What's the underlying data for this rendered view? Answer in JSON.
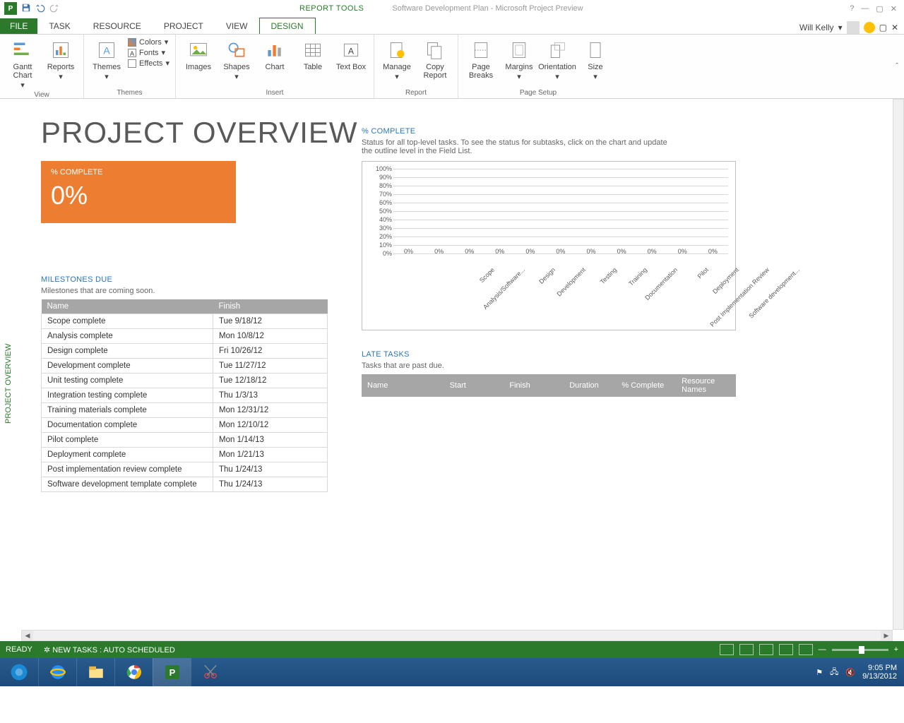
{
  "window": {
    "app_context": "REPORT TOOLS",
    "doc_title": "Software Development Plan - Microsoft Project Preview",
    "user_name": "Will Kelly"
  },
  "tabs": {
    "file": "FILE",
    "task": "TASK",
    "resource": "RESOURCE",
    "project": "PROJECT",
    "view": "VIEW",
    "design": "DESIGN"
  },
  "ribbon": {
    "view": {
      "gantt": "Gantt Chart",
      "reports": "Reports",
      "label": "View"
    },
    "themes": {
      "themes": "Themes",
      "colors": "Colors",
      "fonts": "Fonts",
      "effects": "Effects",
      "label": "Themes"
    },
    "insert": {
      "images": "Images",
      "shapes": "Shapes",
      "chart": "Chart",
      "table": "Table",
      "textbox": "Text Box",
      "label": "Insert"
    },
    "report": {
      "manage": "Manage",
      "copy": "Copy Report",
      "label": "Report"
    },
    "page": {
      "breaks": "Page Breaks",
      "margins": "Margins",
      "orientation": "Orientation",
      "size": "Size",
      "label": "Page Setup"
    }
  },
  "side_tab": "PROJECT OVERVIEW",
  "overview": {
    "title": "PROJECT OVERVIEW",
    "kpi_label": "% COMPLETE",
    "kpi_value": "0%"
  },
  "milestones": {
    "head": "MILESTONES DUE",
    "sub": "Milestones that are coming soon.",
    "col_name": "Name",
    "col_finish": "Finish",
    "rows": [
      {
        "name": "Scope complete",
        "finish": "Tue 9/18/12"
      },
      {
        "name": "Analysis complete",
        "finish": "Mon 10/8/12"
      },
      {
        "name": "Design complete",
        "finish": "Fri 10/26/12"
      },
      {
        "name": "Development complete",
        "finish": "Tue 11/27/12"
      },
      {
        "name": "Unit testing complete",
        "finish": "Tue 12/18/12"
      },
      {
        "name": "Integration testing complete",
        "finish": "Thu 1/3/13"
      },
      {
        "name": "Training materials complete",
        "finish": "Mon 12/31/12"
      },
      {
        "name": "Documentation complete",
        "finish": "Mon 12/10/12"
      },
      {
        "name": "Pilot complete",
        "finish": "Mon 1/14/13"
      },
      {
        "name": "Deployment complete",
        "finish": "Mon 1/21/13"
      },
      {
        "name": "Post implementation review complete",
        "finish": "Thu 1/24/13"
      },
      {
        "name": "Software development template complete",
        "finish": "Thu 1/24/13"
      }
    ]
  },
  "pct": {
    "head": "% COMPLETE",
    "sub": "Status for all top-level tasks. To see the status for subtasks, click on the chart and update the outline level in the Field List."
  },
  "chart_data": {
    "type": "bar",
    "categories": [
      "Scope",
      "Analysis/Software...",
      "Design",
      "Development",
      "Testing",
      "Training",
      "Documentation",
      "Pilot",
      "Deployment",
      "Post Implementation Review",
      "Software development..."
    ],
    "values": [
      0,
      0,
      0,
      0,
      0,
      0,
      0,
      0,
      0,
      0,
      0
    ],
    "bar_labels": [
      "0%",
      "0%",
      "0%",
      "0%",
      "0%",
      "0%",
      "0%",
      "0%",
      "0%",
      "0%",
      "0%"
    ],
    "ylabel": "",
    "ylim": [
      0,
      100
    ],
    "yticks": [
      "0%",
      "10%",
      "20%",
      "30%",
      "40%",
      "50%",
      "60%",
      "70%",
      "80%",
      "90%",
      "100%"
    ]
  },
  "late": {
    "head": "LATE TASKS",
    "sub": "Tasks that are past due.",
    "cols": {
      "name": "Name",
      "start": "Start",
      "finish": "Finish",
      "duration": "Duration",
      "pct": "% Complete",
      "res": "Resource Names"
    }
  },
  "status": {
    "ready": "READY",
    "sched": "NEW TASKS : AUTO SCHEDULED"
  },
  "tray": {
    "time": "9:05 PM",
    "date": "9/13/2012"
  }
}
